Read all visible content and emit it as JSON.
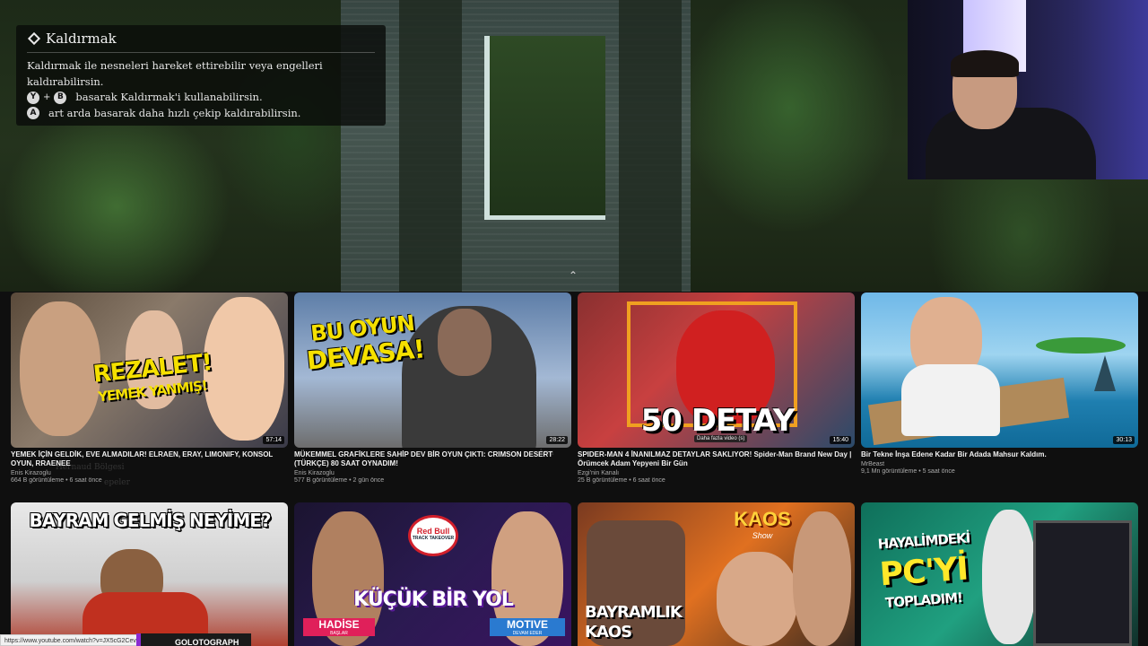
{
  "tutorial": {
    "title": "Kaldırmak",
    "line1": "Kaldırmak ile nesneleri hareket ettirebilir veya engelleri",
    "line2": "kaldırabilirsin.",
    "line3_buttons": [
      "Y",
      "B"
    ],
    "line3_text": "basarak Kaldırmak'i kullanabilirsin.",
    "line4_button": "A",
    "line4_text": "art arda basarak daha hızlı çekip kaldırabilirsin."
  },
  "background_text": {
    "faded1": "Hernaud Bölgesi",
    "faded2": "epeler",
    "faded3": "Ana"
  },
  "videos": [
    {
      "thumb_text_line1": "REZALET!",
      "thumb_text_line2": "YEMEK YANMIŞ!",
      "duration": "57:14",
      "title": "YEMEK İÇİN GELDİK, EVE ALMADILAR! ELRAEN, ERAY, LIMONIFY, KONSOL OYUN, RRAENEE",
      "channel": "Enis Kirazoglu",
      "stats": "664 B görüntüleme • 6 saat önce"
    },
    {
      "thumb_text_line1": "BU OYUN",
      "thumb_text_line2": "DEVASA!",
      "duration": "28:22",
      "title": "MÜKEMMEL GRAFİKLERE SAHİP DEV BİR OYUN ÇIKTI: CRIMSON DESERT (TÜRKÇE) 80 SAAT OYNADIM!",
      "channel": "Enis Kirazoglu",
      "stats": "577 B görüntüleme • 2 gün önce"
    },
    {
      "thumb_text_line1": "50 DETAY",
      "duration": "15:40",
      "title": "SPIDER-MAN 4 İNANILMAZ DETAYLAR SAKLIYOR! Spider-Man Brand New Day | Örümcek Adam Yepyeni Bir Gün",
      "channel": "Ezgi'nin Kanalı",
      "stats": "25 B görüntüleme • 6 saat önce",
      "tooltip": "Daha fazla video (s)"
    },
    {
      "duration": "30:13",
      "title": "Bir Tekne İnşa Edene Kadar Bir Adada Mahsur Kaldım.",
      "channel": "MrBeast",
      "stats": "9,1 Mn görüntüleme • 5 saat önce"
    },
    {
      "thumb_text_line1": "BAYRAM GELMİŞ NEYİME?"
    },
    {
      "thumb_text_line1": "KÜÇÜK BİR YOL",
      "badge_left": "HADİSE",
      "badge_left_sub": "BAŞLAR",
      "badge_right": "MOTIVE",
      "badge_right_sub": "DEVAM EDER",
      "logo_text": "Red Bull",
      "logo_sub": "TRACK TAKEOVER"
    },
    {
      "thumb_text_line1": "BAYRAMLIK",
      "thumb_text_line2": "KAOS",
      "logo_text": "KAOS",
      "logo_sub": "Show"
    },
    {
      "thumb_text_line1": "HAYALİMDEKİ",
      "thumb_text_line2": "PC'Yİ",
      "thumb_text_line3": "TOPLADIM!"
    }
  ],
  "status_bar": {
    "url": "https://www.youtube.com/watch?v=JX5cG2CevSA",
    "partial_title": "GOLOTOGRAPH"
  },
  "colors": {
    "title_yellow": "#f5e000",
    "youtube_bg": "#0f0f0f",
    "meta_gray": "#aaaaaa"
  }
}
